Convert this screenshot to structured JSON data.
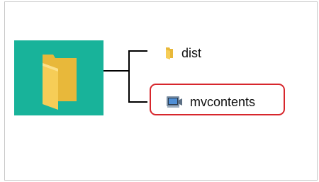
{
  "tree": {
    "root": {
      "icon": "folder-icon",
      "tile_color": "#18b39a"
    },
    "children": [
      {
        "label": "dist",
        "icon": "folder-icon",
        "highlighted": false
      },
      {
        "label": "mvcontents",
        "icon": "video-folder-icon",
        "highlighted": true
      }
    ]
  },
  "colors": {
    "folder": "#f6c94a",
    "highlight_border": "#d7262c",
    "connector": "#000000"
  }
}
